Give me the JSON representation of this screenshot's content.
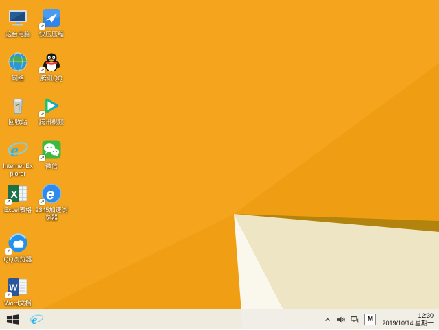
{
  "wallpaper": {
    "base": "#F5A51D",
    "facet_right": "#EF9D12",
    "facet_bottom_left": "#F09F15",
    "facet_dark_edge": "#B2830D",
    "facet_cream": "#EDE5C3",
    "facet_white": "#FAF7EC"
  },
  "desktop": {
    "shortcut_arrow_glyph": "↗",
    "icons": [
      {
        "name": "this-pc",
        "label": "这台电脑",
        "icon": "computer-icon",
        "col": 0,
        "row": 0,
        "shortcut_arrow": false
      },
      {
        "name": "kuaiya",
        "label": "快压压缩",
        "icon": "kuaiya-icon",
        "col": 1,
        "row": 0,
        "shortcut_arrow": true
      },
      {
        "name": "network",
        "label": "网络",
        "icon": "globe-icon",
        "col": 0,
        "row": 1,
        "shortcut_arrow": false
      },
      {
        "name": "tencent-qq",
        "label": "腾讯QQ",
        "icon": "qq-penguin-icon",
        "col": 1,
        "row": 1,
        "shortcut_arrow": true
      },
      {
        "name": "recycle-bin",
        "label": "回收站",
        "icon": "recycle-bin-icon",
        "col": 0,
        "row": 2,
        "shortcut_arrow": false
      },
      {
        "name": "tencent-video",
        "label": "腾讯视频",
        "icon": "tencent-video-icon",
        "col": 1,
        "row": 2,
        "shortcut_arrow": true
      },
      {
        "name": "internet-explorer",
        "label": "Internet Explorer",
        "icon": "ie-icon",
        "col": 0,
        "row": 3,
        "shortcut_arrow": false
      },
      {
        "name": "wechat",
        "label": "微信",
        "icon": "wechat-icon",
        "col": 1,
        "row": 3,
        "shortcut_arrow": true
      },
      {
        "name": "excel",
        "label": "Excel表格",
        "icon": "excel-icon",
        "col": 0,
        "row": 4,
        "shortcut_arrow": true
      },
      {
        "name": "2345-browser",
        "label": "2345加速浏览器",
        "icon": "2345-browser-icon",
        "col": 1,
        "row": 4,
        "shortcut_arrow": true
      },
      {
        "name": "qq-browser",
        "label": "QQ浏览器",
        "icon": "qq-browser-icon",
        "col": 0,
        "row": 5,
        "shortcut_arrow": true
      },
      {
        "name": "word",
        "label": "Word文档",
        "icon": "word-icon",
        "col": 0,
        "row": 6,
        "shortcut_arrow": true
      }
    ]
  },
  "taskbar": {
    "start_button": {
      "icon": "windows-logo-icon"
    },
    "pinned": [
      {
        "name": "internet-explorer",
        "icon": "ie-icon"
      }
    ],
    "tray": {
      "icons": [
        "hidden-icons-chevron-icon",
        "volume-icon",
        "network-icon"
      ],
      "input_method_indicator": "M",
      "clock": {
        "time": "12:30",
        "date": "2019/10/14 星期一"
      }
    }
  }
}
